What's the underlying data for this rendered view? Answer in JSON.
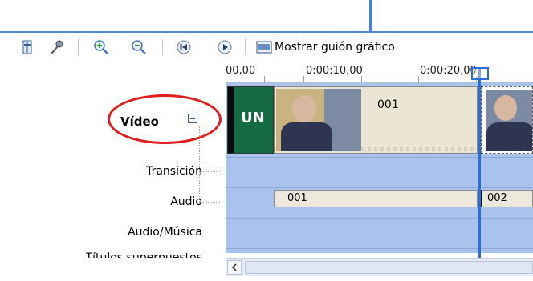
{
  "toolbar": {
    "storyboard_label": "Mostrar guión gráfico",
    "icons": [
      "set-audio-levels-icon",
      "narrate-timeline-icon",
      "zoom-in-icon",
      "zoom-out-icon",
      "rewind-icon",
      "play-icon",
      "storyboard-icon"
    ]
  },
  "ruler": {
    "labels": [
      "00,00",
      "0:00:10,00",
      "0:00:20,00"
    ]
  },
  "tracks": {
    "video": "Vídeo",
    "transition": "Transición",
    "audio": "Audio",
    "audio_music": "Audio/Música",
    "title_overlay_partial": "Títulos superpuestos"
  },
  "clips": {
    "video_clip_1": "001",
    "audio_clip_1": "001",
    "audio_clip_2": "002",
    "logo_text": "UN"
  },
  "colors": {
    "track_bg": "#a9c3ec",
    "playhead": "#2b6ed8",
    "highlight_ellipse": "#e01c1c"
  }
}
